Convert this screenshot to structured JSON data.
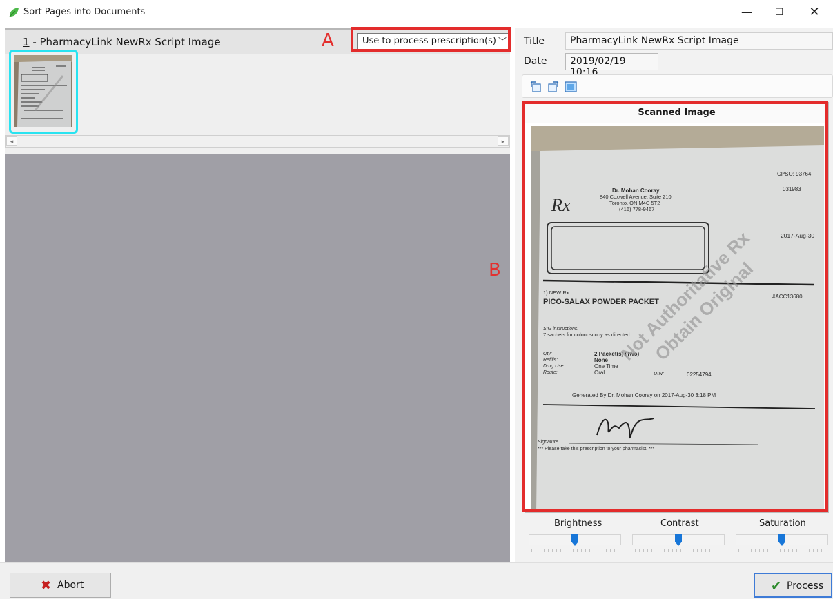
{
  "window": {
    "title": "Sort Pages into Documents",
    "minimize_glyph": "—",
    "maximize_glyph": "☐",
    "close_glyph": "✕"
  },
  "document": {
    "index": "1",
    "name": " - PharmacyLink NewRx Script Image",
    "purpose_selected": "Use to process prescription(s)"
  },
  "scroll": {
    "left_arrow": "◂",
    "right_arrow": "▸"
  },
  "details": {
    "title_label": "Title",
    "title_value": "PharmacyLink NewRx Script Image",
    "date_label": "Date",
    "date_value": "2019/02/19 10:16"
  },
  "viewer": {
    "header": "Scanned Image"
  },
  "adjustments": {
    "brightness_label": "Brightness",
    "contrast_label": "Contrast",
    "saturation_label": "Saturation",
    "brightness": 0.5,
    "contrast": 0.5,
    "saturation": 0.5
  },
  "annotations": {
    "a": "A",
    "b": "B",
    "color": "#e32c2c"
  },
  "footer": {
    "abort_label": "Abort",
    "process_label": "Process"
  },
  "prescription": {
    "cpso": "CPSO: 93764",
    "number": "031983",
    "rx": "Rx",
    "doctor": "Dr. Mohan Cooray",
    "address1": "840 Coxwell Avenue, Suite 210",
    "address2": "Toronto, ON  M4C 5T2",
    "phone": "(416) 778-9467",
    "date": "2017-Aug-30",
    "new_rx": "1) NEW Rx",
    "ref": "#ACC13680",
    "drug": "PICO-SALAX POWDER PACKET",
    "sig_label": "SIG instructions:",
    "sig_text": "7 sachets for colonoscopy as directed",
    "qty_label": "Qty:",
    "qty_value": "2 Packet(s) (Two)",
    "refills_label": "Refills:",
    "refills_value": "None",
    "druguse_label": "Drug Use:",
    "druguse_value": "One Time",
    "route_label": "Route:",
    "route_value": "Oral",
    "din_label": "DIN:",
    "din_value": "02254794",
    "generated": "Generated By Dr. Mohan Cooray on 2017-Aug-30 3:18 PM",
    "signature_label": "Signature",
    "footer_note": "*** Please take this prescription to your pharmacist. ***",
    "watermark1": "Not Authoritative Rx",
    "watermark2": "Obtain Original"
  }
}
